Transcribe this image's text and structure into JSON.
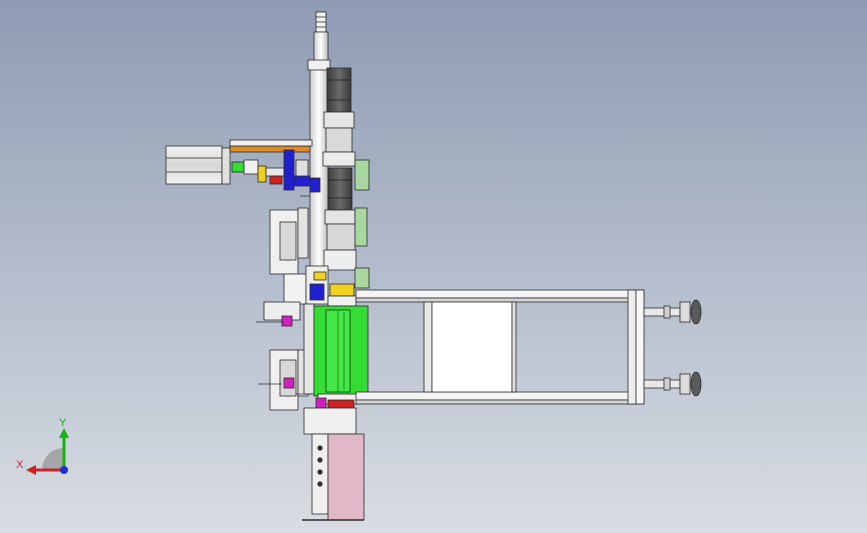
{
  "triad": {
    "x_label": "X",
    "y_label": "Y",
    "x_color": "#d42020",
    "y_color": "#18b018",
    "z_color": "#2030d0"
  },
  "colors": {
    "background_top": "#8f9bb3",
    "background_bottom": "#d9dde3",
    "steel": "#e8e8e8",
    "outline": "#2a2a2a",
    "green": "#33dd33",
    "light_green": "#a8d8a0",
    "pink": "#e0b8c8",
    "magenta": "#d020c0",
    "blue": "#2020d0",
    "yellow": "#f0d020",
    "orange": "#e08a20",
    "motor": "#555555"
  }
}
